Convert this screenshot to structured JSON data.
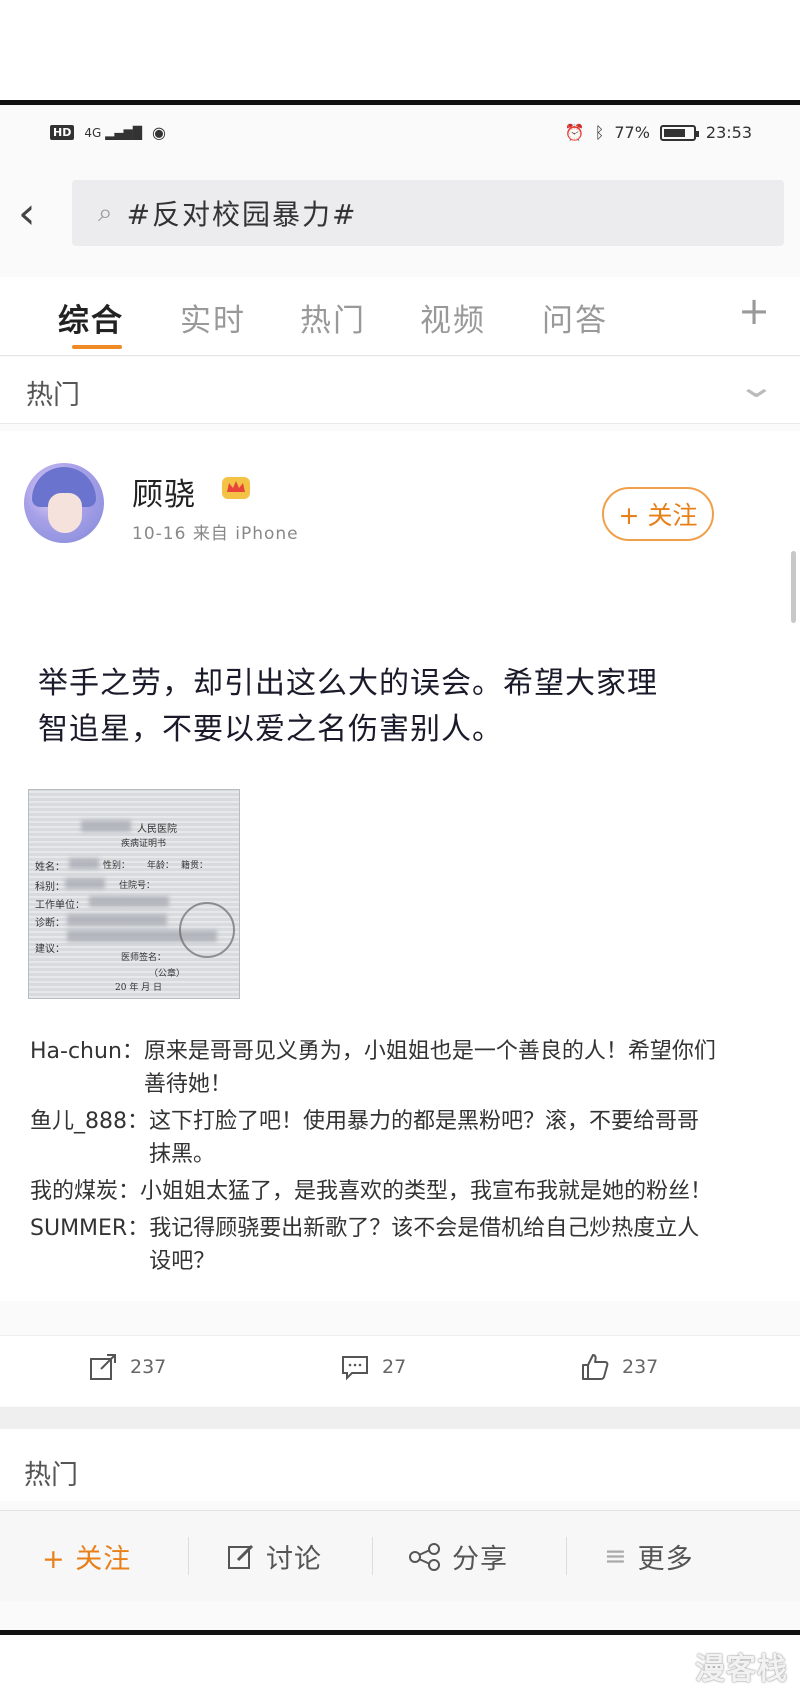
{
  "status_bar": {
    "hd": "HD",
    "network": "4G",
    "battery_percent": "77%",
    "battery_level": 0.77,
    "time": "23:53"
  },
  "search": {
    "query": "#反对校园暴力#"
  },
  "tabs": [
    {
      "label": "综合",
      "active": true
    },
    {
      "label": "实时",
      "active": false
    },
    {
      "label": "热门",
      "active": false
    },
    {
      "label": "视频",
      "active": false
    },
    {
      "label": "问答",
      "active": false
    }
  ],
  "tabs_more": "+",
  "section": {
    "title": "热门"
  },
  "post": {
    "username": "顾骁",
    "date": "10-16",
    "source": "来自 iPhone",
    "follow_label": "+ 关注",
    "text": "举手之劳，却引出这么大的误会。希望大家理智追星，不要以爱之名伤害别人。",
    "image": {
      "hospital": "人民医院",
      "cert_title": "疾病证明书",
      "field_name": "姓名：",
      "field_gender": "性别：",
      "field_age": "年龄：",
      "field_origin": "籍贯：",
      "field_dept": "科别：",
      "field_admission": "住院号：",
      "field_work": "工作单位：",
      "field_diag": "诊断：",
      "field_advice": "建议：",
      "field_doctor": "医师签名：",
      "field_seal": "（公章）",
      "field_date": "20    年    月    日"
    },
    "comments": [
      {
        "author": "Ha-chun：",
        "text": "原来是哥哥见义勇为，小姐姐也是一个善良的人！希望你们善待她！"
      },
      {
        "author": "鱼儿_888：",
        "text": "这下打脸了吧！使用暴力的都是黑粉吧？滚，不要给哥哥抹黑。"
      },
      {
        "author": "我的煤炭：",
        "text": "小姐姐太猛了，是我喜欢的类型，我宣布我就是她的粉丝！"
      },
      {
        "author": "SUMMER：",
        "text": "我记得顾骁要出新歌了？该不会是借机给自己炒热度立人设吧？"
      }
    ],
    "actions": {
      "repost_count": "237",
      "comment_count": "27",
      "like_count": "237"
    }
  },
  "section2": {
    "title": "热门"
  },
  "toolbar": {
    "follow": "+ 关注",
    "discuss": "讨论",
    "share": "分享",
    "more": "更多"
  },
  "watermark": "漫客栈"
}
